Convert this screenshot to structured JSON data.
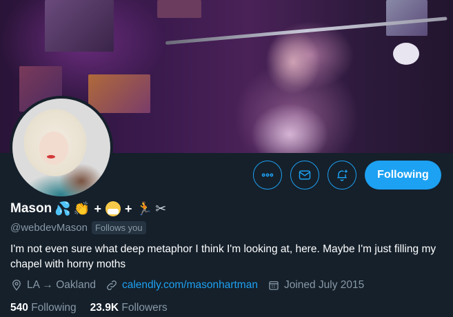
{
  "profile": {
    "display_name": "Mason",
    "name_emojis": {
      "drops": "💦",
      "clap": "👏",
      "plus1": "+",
      "mask": "😷",
      "plus2": "+",
      "runner": "🏃",
      "scissors": "✂"
    },
    "handle": "@webdevMason",
    "follows_you_label": "Follows you",
    "bio": "I'm not even sure what deep metaphor I think I'm looking at, here. Maybe I'm just filling my chapel with horny moths",
    "location": "LA → Oakland",
    "website": "calendly.com/masonhartman",
    "joined": "Joined July 2015"
  },
  "stats": {
    "following_count": "540",
    "following_label": "Following",
    "followers_count": "23.9K",
    "followers_label": "Followers"
  },
  "actions": {
    "more_icon": "more-icon",
    "message_icon": "mail-icon",
    "notify_icon": "bell-plus-icon",
    "following_label": "Following"
  },
  "colors": {
    "background": "#15202b",
    "accent": "#1da1f2",
    "muted_text": "#8899a6"
  }
}
